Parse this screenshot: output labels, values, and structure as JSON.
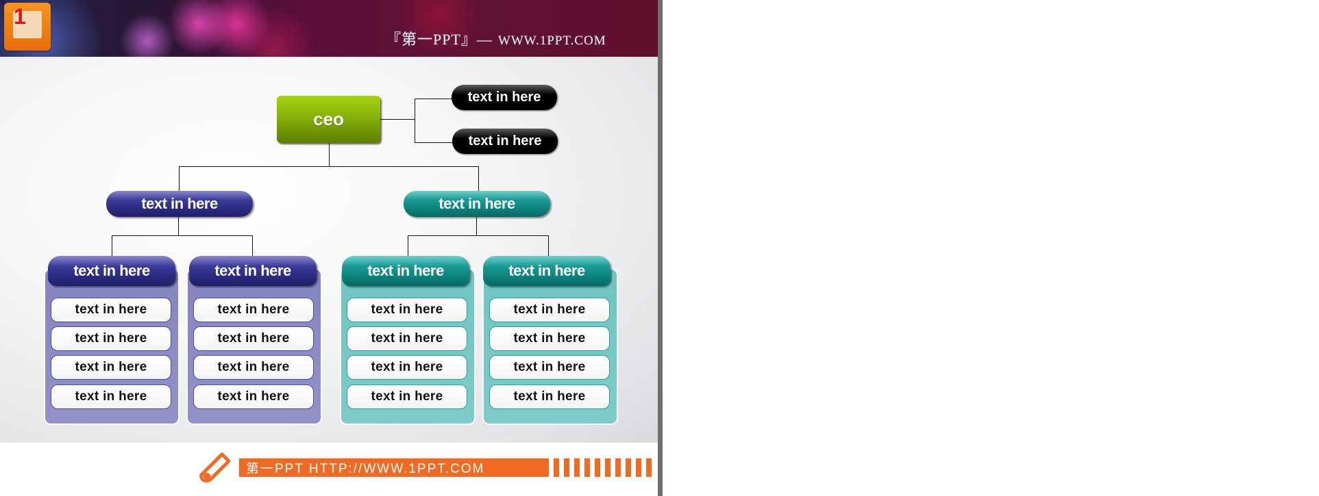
{
  "header": {
    "logo_badge": "1",
    "title": "『第一PPT』—",
    "url": "WWW.1PPT.COM"
  },
  "org_chart": {
    "root": {
      "label": "ceo",
      "color": "#86b10a"
    },
    "assistants": [
      {
        "label": "text in here"
      },
      {
        "label": "text in here"
      }
    ],
    "branches": [
      {
        "label": "text in here",
        "color": "#2a2a80",
        "groups": [
          {
            "label": "text in here",
            "items": [
              "text in here",
              "text in here",
              "text in here",
              "text in here"
            ]
          },
          {
            "label": "text in here",
            "items": [
              "text in here",
              "text in here",
              "text in here",
              "text in here"
            ]
          }
        ]
      },
      {
        "label": "text in here",
        "color": "#0b817b",
        "groups": [
          {
            "label": "text in here",
            "items": [
              "text in here",
              "text in here",
              "text in here",
              "text in here"
            ]
          },
          {
            "label": "text in here",
            "items": [
              "text in here",
              "text in here",
              "text in here",
              "text in here"
            ]
          }
        ]
      }
    ]
  },
  "footer": {
    "text": "第一PPT HTTP://WWW.1PPT.COM",
    "accent": "#f16a22"
  }
}
